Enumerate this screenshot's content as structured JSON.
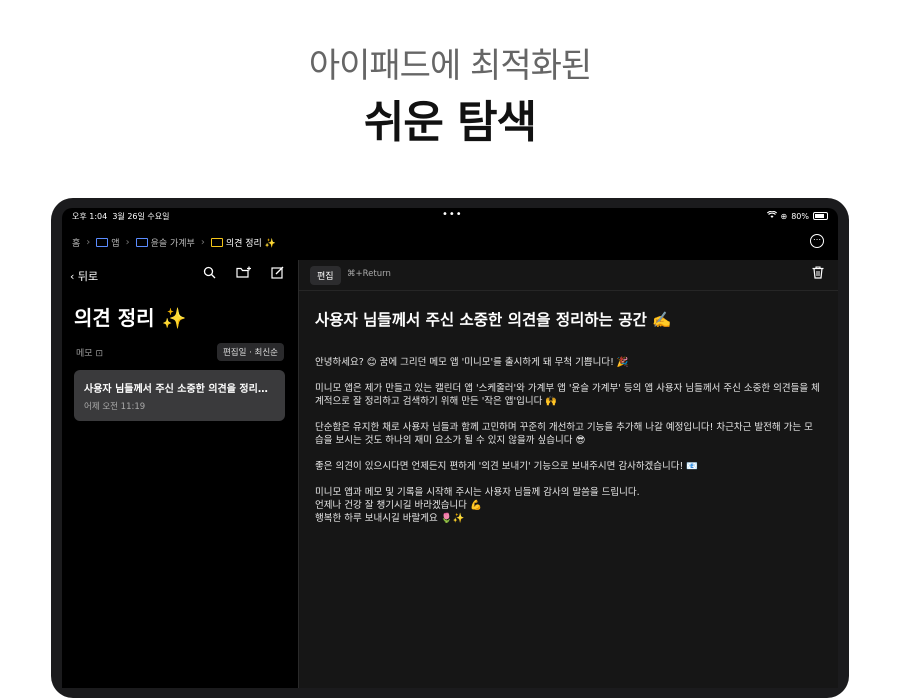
{
  "hero": {
    "subtitle": "아이패드에 최적화된",
    "title": "쉬운 탐색"
  },
  "status_bar": {
    "time": "오후 1:04",
    "date": "3월 26일 수요일",
    "wifi": "wifi-icon",
    "battery_pct": "80%"
  },
  "breadcrumb": {
    "home": "홈",
    "items": [
      "앱",
      "윤슬 가계부",
      "의견 정리 ✨"
    ]
  },
  "sidebar": {
    "back_label": "뒤로",
    "title": "의견 정리 ✨",
    "memo_label": "메모",
    "sort_label": "편집일 · 최신순",
    "notes": [
      {
        "title": "사용자 님들께서 주신 소중한 의견을 정리하는 공간 ✍️",
        "date": "어제 오전 11:19"
      }
    ]
  },
  "editor": {
    "edit_label": "편집",
    "shortcut": "⌘+Return",
    "title": "사용자 님들께서 주신 소중한 의견을 정리하는 공간 ✍️",
    "paragraphs": [
      "안녕하세요? 😊 꿈에 그리던 메모 앱 '미니모'를 출시하게 돼 무척 기쁩니다! 🎉",
      "미니모 앱은 제가 만들고 있는 캘린더 앱 '스케줄러'와 가계부 앱 '윤슬 가계부' 등의 앱 사용자 님들께서 주신 소중한 의견들을 체계적으로 잘 정리하고 검색하기 위해 만든 '작은 앱'입니다 🙌",
      "단순함은 유지한 채로 사용자 님들과 함께 고민하며 꾸준히 개선하고 기능을 추가해 나갈 예정입니다! 차근차근 발전해 가는 모습을 보시는 것도 하나의 재미 요소가 될 수 있지 않을까 싶습니다 😎",
      "좋은 의견이 있으시다면 언제든지 편하게 '의견 보내기' 기능으로 보내주시면 감사하겠습니다! 📧",
      "미니모 앱과 메모 및 기록을 시작해 주시는 사용자 님들께 감사의 말씀을 드립니다.\n언제나 건강 잘 챙기시길 바라겠습니다 💪\n행복한 하루 보내시길 바랄게요 🌷✨"
    ]
  }
}
